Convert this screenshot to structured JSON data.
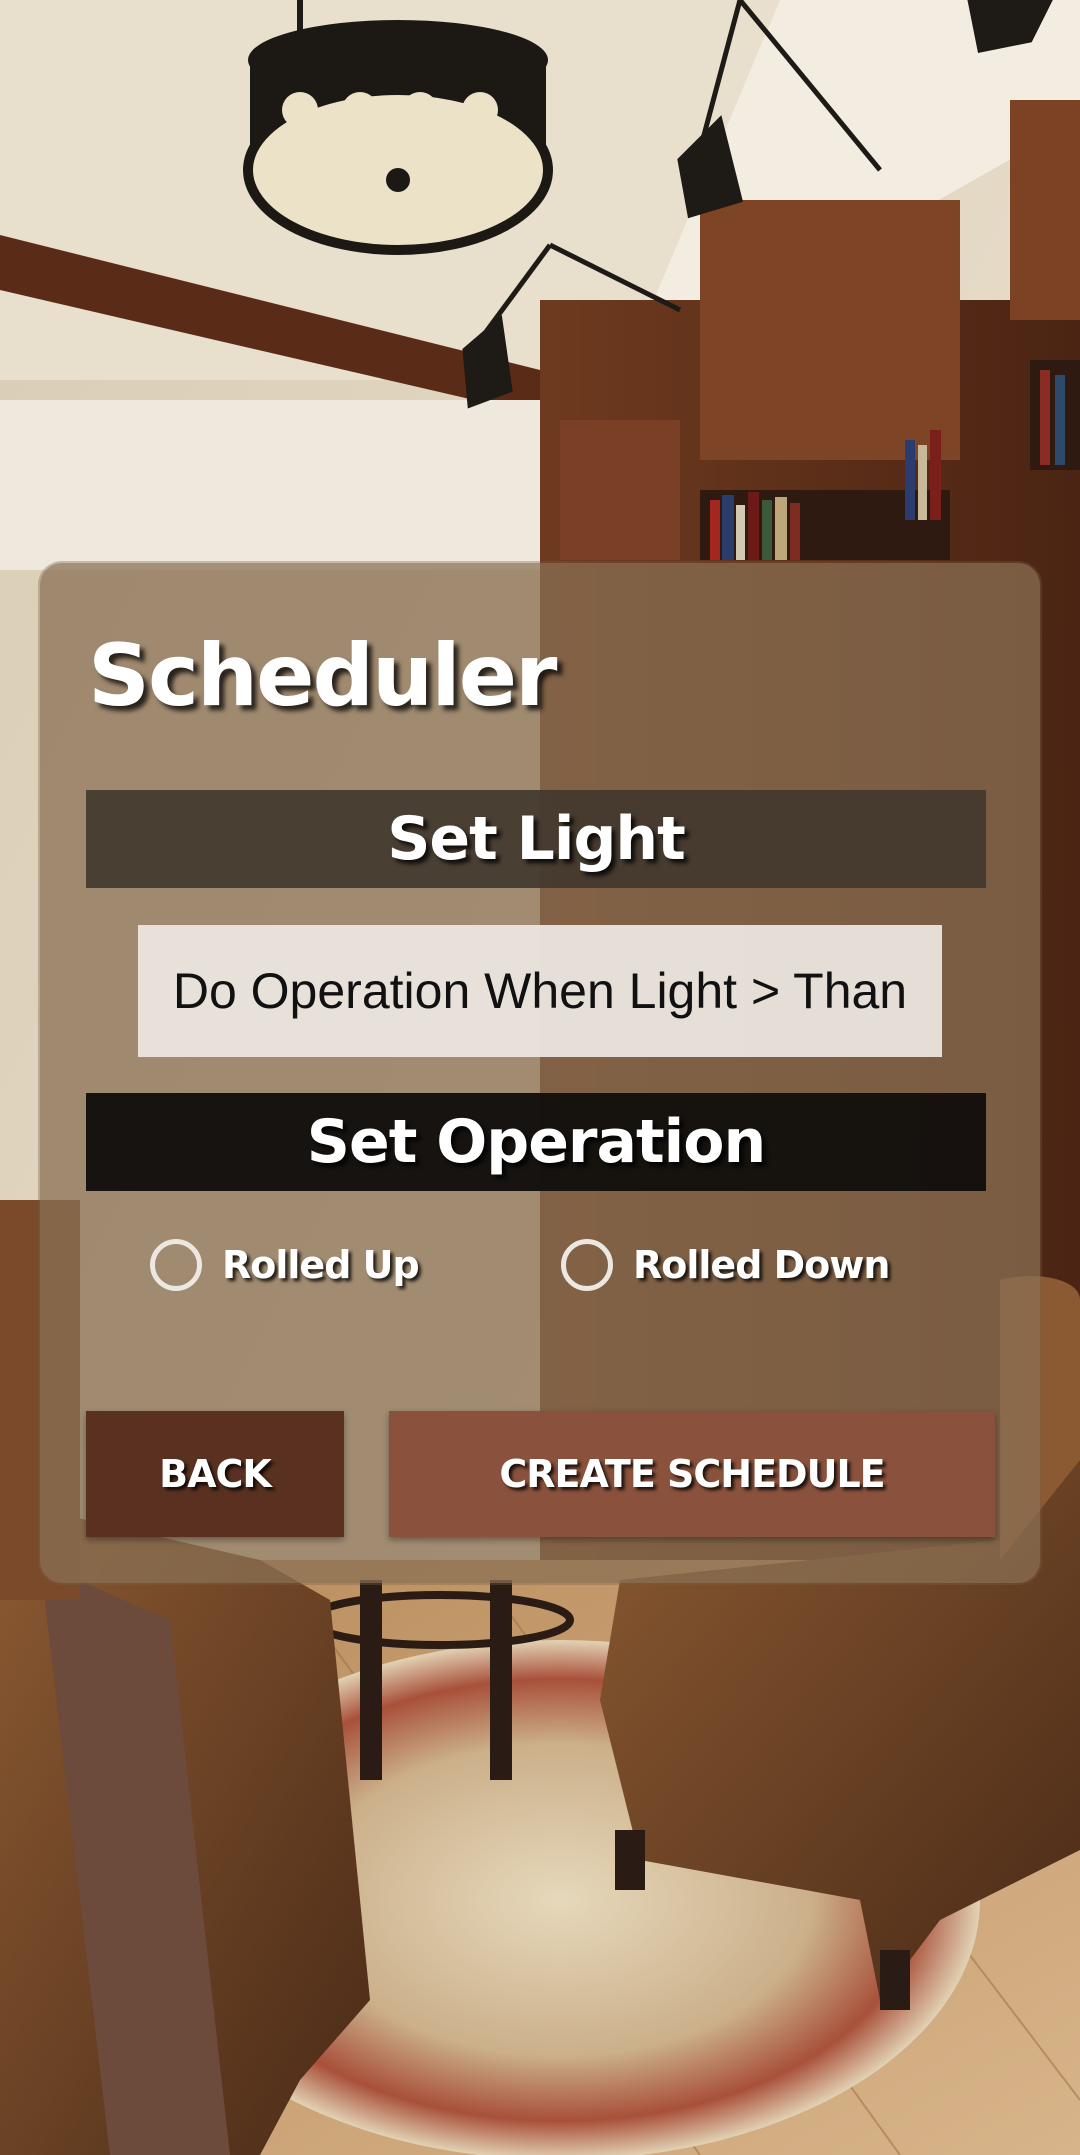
{
  "scheduler": {
    "title": "Scheduler",
    "set_light_heading": "Set Light",
    "light_threshold_input": {
      "value": "",
      "placeholder": "Do Operation When Light > Than"
    },
    "set_operation_heading": "Set Operation",
    "operation_options": [
      {
        "label": "Rolled Up",
        "selected": false
      },
      {
        "label": "Rolled Down",
        "selected": false
      }
    ],
    "buttons": {
      "back_label": "BACK",
      "create_label": "CREATE SCHEDULE"
    }
  },
  "colors": {
    "card_overlay": "#8a7054",
    "set_light_bar": "#42382e",
    "set_operation_bar": "#120f0c",
    "input_background": "#ece7e0",
    "back_button": "#5a3120",
    "create_button": "#8a523c",
    "heading_text": "#ffffff"
  },
  "icons": {
    "radio_unselected": "radio-unselected-icon"
  }
}
